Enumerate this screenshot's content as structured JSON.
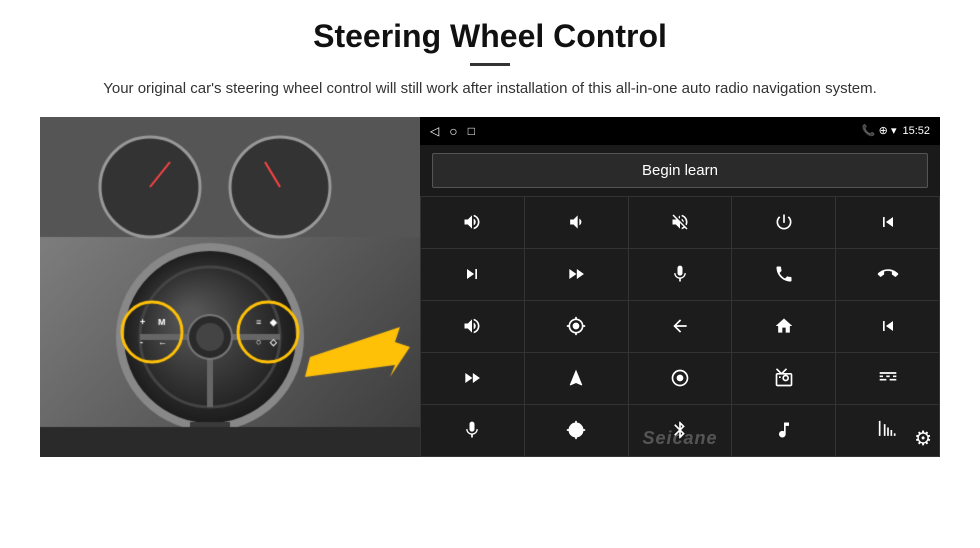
{
  "header": {
    "title": "Steering Wheel Control",
    "subtitle": "Your original car's steering wheel control will still work after installation of this all-in-one auto radio navigation system."
  },
  "status_bar": {
    "time": "15:52",
    "nav_back": "◁",
    "nav_home": "○",
    "nav_recent": "□"
  },
  "begin_learn": {
    "label": "Begin learn"
  },
  "controls": [
    {
      "id": "vol-up",
      "symbol": "🔊+"
    },
    {
      "id": "vol-down",
      "symbol": "🔉-"
    },
    {
      "id": "mute",
      "symbol": "🔇"
    },
    {
      "id": "power",
      "symbol": "⏻"
    },
    {
      "id": "prev-track",
      "symbol": "⏮"
    },
    {
      "id": "next",
      "symbol": "⏭"
    },
    {
      "id": "ff",
      "symbol": "⏩"
    },
    {
      "id": "mic",
      "symbol": "🎤"
    },
    {
      "id": "phone",
      "symbol": "📞"
    },
    {
      "id": "hang-up",
      "symbol": "📵"
    },
    {
      "id": "horn",
      "symbol": "📣"
    },
    {
      "id": "cam360",
      "symbol": "🔄"
    },
    {
      "id": "back",
      "symbol": "↩"
    },
    {
      "id": "home",
      "symbol": "⌂"
    },
    {
      "id": "skip-back",
      "symbol": "⏮"
    },
    {
      "id": "fast-fwd",
      "symbol": "⏭"
    },
    {
      "id": "nav",
      "symbol": "▶"
    },
    {
      "id": "source",
      "symbol": "⏏"
    },
    {
      "id": "radio",
      "symbol": "📻"
    },
    {
      "id": "eq",
      "symbol": "🎛"
    },
    {
      "id": "mic2",
      "symbol": "🎙"
    },
    {
      "id": "settings2",
      "symbol": "⚙"
    },
    {
      "id": "bluetooth",
      "symbol": "✦"
    },
    {
      "id": "music",
      "symbol": "🎵"
    },
    {
      "id": "bars",
      "symbol": "📶"
    }
  ],
  "watermark": {
    "text": "Seicane"
  },
  "colors": {
    "background": "#ffffff",
    "android_bg": "#111111",
    "status_bar_bg": "#000000",
    "button_bg": "#1c1c1c",
    "grid_gap": "#333333"
  }
}
